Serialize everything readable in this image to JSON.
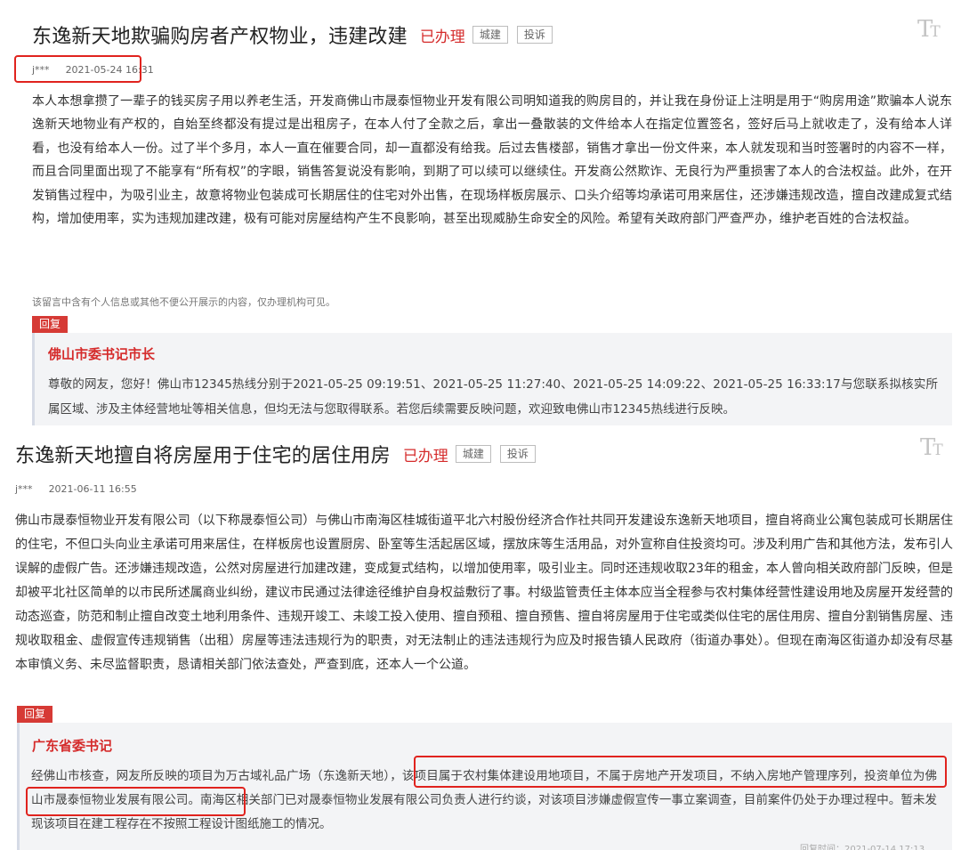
{
  "post1": {
    "title": "东逸新天地欺骗购房者产权物业，违建改建",
    "status": "已办理",
    "tag1": "城建",
    "tag2": "投诉",
    "font_icon": "font-size-icon",
    "user": "j***",
    "date": "2021-05-24 16:31",
    "content": "本人本想拿攒了一辈子的钱买房子用以养老生活，开发商佛山市晟泰恒物业开发有限公司明知道我的购房目的，并让我在身份证上注明是用于“购房用途”欺骗本人说东逸新天地物业有产权的，自始至终都没有提过是出租房子，在本人付了全款之后，拿出一叠散装的文件给本人在指定位置签名，签好后马上就收走了，没有给本人详看，也没有给本人一份。过了半个多月，本人一直在催要合同，却一直都没有给我。后过去售楼部，销售才拿出一份文件来，本人就发现和当时签署时的内容不一样，而且合同里面出现了不能享有“所有权”的字眼，销售答复说没有影响，到期了可以续可以继续住。开发商公然欺诈、无良行为严重损害了本人的合法权益。此外，在开发销售过程中，为吸引业主，故意将物业包装成可长期居住的住宅对外出售，在现场样板房展示、口头介绍等均承诺可用来居住，还涉嫌违规改造，擅自改建成复式结构，增加使用率，实为违规加建改建，极有可能对房屋结构产生不良影响，甚至出现威胁生命安全的风险。希望有关政府部门严查严办，维护老百姓的合法权益。",
    "privacy_note": "该留言中含有个人信息或其他不便公开展示的内容，仅办理机构可见。",
    "reply_badge": "回复",
    "replier": "佛山市委书记市长",
    "reply": "尊敬的网友，您好！佛山市12345热线分别于2021-05-25 09:19:51、2021-05-25 11:27:40、2021-05-25 14:09:22、2021-05-25 16:33:17与您联系拟核实所属区域、涉及主体经营地址等相关信息，但均无法与您取得联系。若您后续需要反映问题，欢迎致电佛山市12345热线进行反映。"
  },
  "post2": {
    "title": "东逸新天地擅自将房屋用于住宅的居住用房",
    "status": "已办理",
    "tag1": "城建",
    "tag2": "投诉",
    "font_icon": "font-size-icon",
    "user": "j***",
    "date": "2021-06-11 16:55",
    "content": "佛山市晟泰恒物业开发有限公司（以下称晟泰恒公司）与佛山市南海区桂城街道平北六村股份经济合作社共同开发建设东逸新天地项目，擅自将商业公寓包装成可长期居住的住宅，不但口头向业主承诺可用来居住，在样板房也设置厨房、卧室等生活起居区域，摆放床等生活用品，对外宣称自住投资均可。涉及利用广告和其他方法，发布引人误解的虚假广告。还涉嫌违规改造，公然对房屋进行加建改建，变成复式结构，以增加使用率，吸引业主。同时还违规收取23年的租金，本人曾向相关政府部门反映，但是却被平北社区简单的以市民所述属商业纠纷，建议市民通过法律途径维护自身权益敷衍了事。村级监管责任主体本应当全程参与农村集体经营性建设用地及房屋开发经营的动态巡查，防范和制止擅自改变土地利用条件、违规开竣工、未竣工投入使用、擅自预租、擅自预售、擅自将房屋用于住宅或类似住宅的居住用房、擅自分割销售房屋、违规收取租金、虚假宣传违规销售（出租）房屋等违法违规行为的职责，对无法制止的违法违规行为应及时报告镇人民政府（街道办事处）。但现在南海区街道办却没有尽基本审慎义务、未尽监督职责，恳请相关部门依法查处，严查到底，还本人一个公道。",
    "reply_badge": "回复",
    "replier": "广东省委书记",
    "reply": "经佛山市核查，网友所反映的项目为万古域礼品广场（东逸新天地），该项目属于农村集体建设用地项目，不属于房地产开发项目，不纳入房地产管理序列，投资单位为佛山市晟泰恒物业发展有限公司。南海区相关部门已对晟泰恒物业发展有限公司负责人进行约谈，对该项目涉嫌虚假宣传一事立案调查，目前案件仍处于办理过程中。暂未发现该项目在建工程存在不按照工程设计图纸施工的情况。",
    "reply_time_partial": "回复时间：2021-07-14 17:13"
  },
  "colors": {
    "accent_red": "#d52b2b",
    "badge_red": "#d63a35",
    "highlight_red": "#e0231e",
    "reply_bg": "#f3f4f6"
  }
}
